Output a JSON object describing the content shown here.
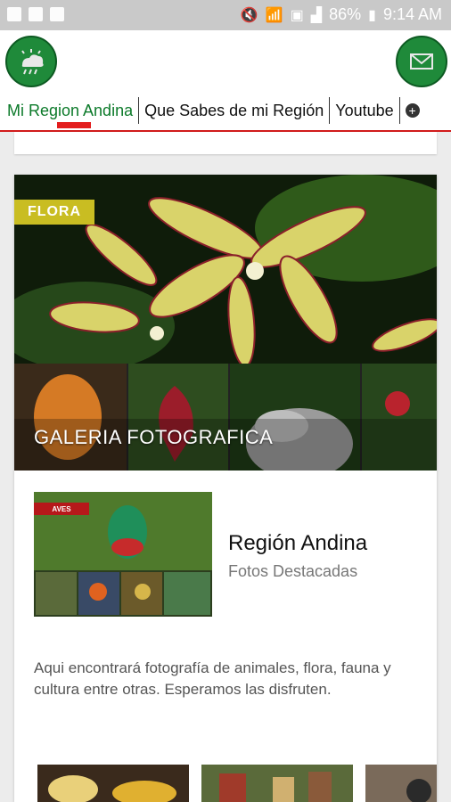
{
  "status_bar": {
    "left_icons": [
      "image-icon",
      "facebook-icon",
      "news-icon"
    ],
    "right_icons": [
      "mute-icon",
      "wifi-icon",
      "sim-icon",
      "signal-icon",
      "battery-icon"
    ],
    "battery": "86%",
    "time": "9:14 AM"
  },
  "appbar": {
    "left_icon": "weather-cloud-icon",
    "right_icon": "mail-icon"
  },
  "tabs": [
    {
      "label": "Mi Region Andina",
      "active": true
    },
    {
      "label": "Que Sabes de mi Región",
      "active": false
    },
    {
      "label": "Youtube",
      "active": false
    }
  ],
  "tabs_more_icon": "plus-circle-icon",
  "flora_badge": "FLORA",
  "gallery_title": "GALERIA FOTOGRAFICA",
  "featured": {
    "badge": "AVES",
    "title": "Región Andina",
    "subtitle": "Fotos Destacadas"
  },
  "description": "Aqui encontrará fotografía de animales, flora, fauna y cultura entre otras. Esperamos las disfruten.",
  "colors": {
    "accent_green": "#1f8a3a",
    "tab_indicator": "#e31d1d",
    "flora_badge": "#c9bd22",
    "aves_badge": "#b6181a"
  }
}
